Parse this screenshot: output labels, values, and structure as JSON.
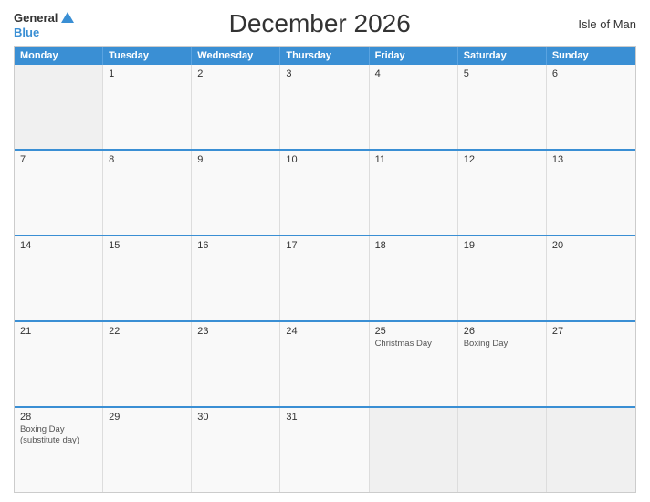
{
  "header": {
    "title": "December 2026",
    "region": "Isle of Man",
    "logo": {
      "general": "General",
      "blue": "Blue"
    }
  },
  "calendar": {
    "days_of_week": [
      "Monday",
      "Tuesday",
      "Wednesday",
      "Thursday",
      "Friday",
      "Saturday",
      "Sunday"
    ],
    "weeks": [
      [
        {
          "day": "",
          "empty": true
        },
        {
          "day": "1",
          "empty": false
        },
        {
          "day": "2",
          "empty": false
        },
        {
          "day": "3",
          "empty": false
        },
        {
          "day": "4",
          "empty": false
        },
        {
          "day": "5",
          "empty": false
        },
        {
          "day": "6",
          "empty": false
        }
      ],
      [
        {
          "day": "7",
          "empty": false
        },
        {
          "day": "8",
          "empty": false
        },
        {
          "day": "9",
          "empty": false
        },
        {
          "day": "10",
          "empty": false
        },
        {
          "day": "11",
          "empty": false
        },
        {
          "day": "12",
          "empty": false
        },
        {
          "day": "13",
          "empty": false
        }
      ],
      [
        {
          "day": "14",
          "empty": false
        },
        {
          "day": "15",
          "empty": false
        },
        {
          "day": "16",
          "empty": false
        },
        {
          "day": "17",
          "empty": false
        },
        {
          "day": "18",
          "empty": false
        },
        {
          "day": "19",
          "empty": false
        },
        {
          "day": "20",
          "empty": false
        }
      ],
      [
        {
          "day": "21",
          "empty": false
        },
        {
          "day": "22",
          "empty": false
        },
        {
          "day": "23",
          "empty": false
        },
        {
          "day": "24",
          "empty": false
        },
        {
          "day": "25",
          "holiday": "Christmas Day",
          "empty": false
        },
        {
          "day": "26",
          "holiday": "Boxing Day",
          "empty": false
        },
        {
          "day": "27",
          "empty": false
        }
      ],
      [
        {
          "day": "28",
          "holiday": "Boxing Day\n(substitute day)",
          "empty": false
        },
        {
          "day": "29",
          "empty": false
        },
        {
          "day": "30",
          "empty": false
        },
        {
          "day": "31",
          "empty": false
        },
        {
          "day": "",
          "empty": true
        },
        {
          "day": "",
          "empty": true
        },
        {
          "day": "",
          "empty": true
        }
      ]
    ]
  }
}
